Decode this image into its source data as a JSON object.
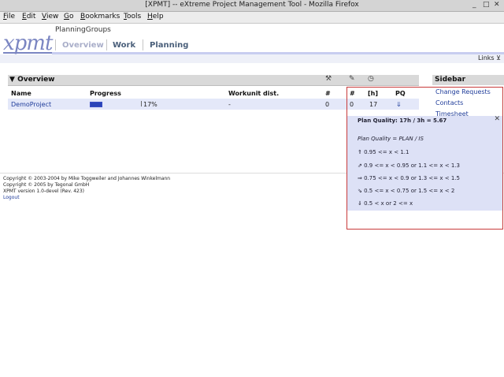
{
  "window": {
    "title": "[XPMT] -- eXtreme Project Management Tool - Mozilla Firefox",
    "controls": [
      "_",
      "□",
      "✕"
    ]
  },
  "menu": [
    {
      "underline": "F",
      "rest": "ile"
    },
    {
      "underline": "E",
      "rest": "dit"
    },
    {
      "underline": "V",
      "rest": "iew"
    },
    {
      "underline": "G",
      "rest": "o"
    },
    {
      "underline": "B",
      "rest": "ookmarks"
    },
    {
      "underline": "T",
      "rest": "ools"
    },
    {
      "underline": "H",
      "rest": "elp"
    }
  ],
  "header": {
    "logo_text": "xpmt",
    "group": "PlanningGroups",
    "nav": [
      "Overview",
      "Work",
      "Planning"
    ],
    "links": "Links"
  },
  "overview": {
    "title": "Overview",
    "columns": [
      "Name",
      "Progress",
      "Workunit dist.",
      "#",
      "#",
      "[h]",
      "PQ"
    ],
    "row": {
      "name": "DemoProject",
      "progress": 17,
      "progress_label": "17%",
      "workunit": "-",
      "count1": "0",
      "count2": "0",
      "hours": "17"
    }
  },
  "sidebar": {
    "title": "Sidebar",
    "items": [
      "Change Requests",
      "Contacts",
      "Timesheet"
    ]
  },
  "popup": {
    "title": "Plan Quality: 17h / 3h = 5.67",
    "formula": "Plan Quality = PLAN / IS",
    "ranges": [
      "0.95 <= x < 1.1",
      "0.9 <= x < 0.95 or 1.1 <= x < 1.3",
      "0.75 <= x < 0.9 or 1.3 <= x < 1.5",
      "0.5 <= x < 0.75 or 1.5 <= x < 2",
      "0.5 < x or 2 <= x"
    ],
    "close": "✕"
  },
  "footer": {
    "copyright1": "Copyright © 2003-2004 by Mike Toggweiler and Johannes Winkelmann",
    "copyright2": "Copyright © 2005 by Tegonal GmbH",
    "version": "XPMT version 1.0-devel (Rev. 423)",
    "logout": "Logout"
  },
  "colors": {
    "nav_active": "#a9aec9",
    "nav_inactive": "#4a5f7a",
    "link": "#1f3c9a",
    "progress": "#2a44b8"
  }
}
